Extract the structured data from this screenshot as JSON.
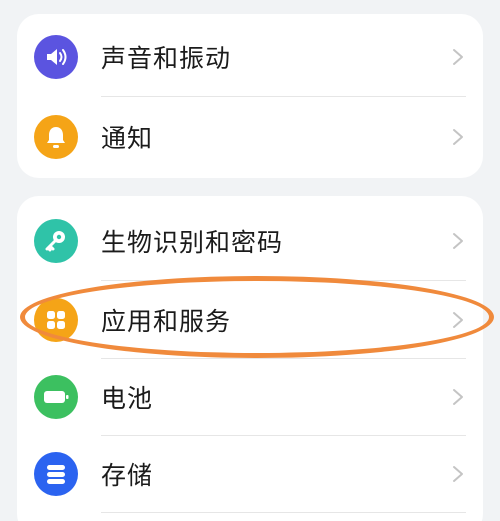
{
  "group1": {
    "items": [
      {
        "label": "声音和振动",
        "icon": "speaker-icon",
        "color": "#5b54e0"
      },
      {
        "label": "通知",
        "icon": "bell-icon",
        "color": "#f5a417"
      }
    ]
  },
  "group2": {
    "items": [
      {
        "label": "生物识别和密码",
        "icon": "key-icon",
        "color": "#2fc3a8"
      },
      {
        "label": "应用和服务",
        "icon": "apps-icon",
        "color": "#f5a417"
      },
      {
        "label": "电池",
        "icon": "battery-icon",
        "color": "#3cc060"
      },
      {
        "label": "存储",
        "icon": "storage-icon",
        "color": "#2b63f0"
      }
    ]
  },
  "annotation": {
    "color": "#f08a3c"
  }
}
